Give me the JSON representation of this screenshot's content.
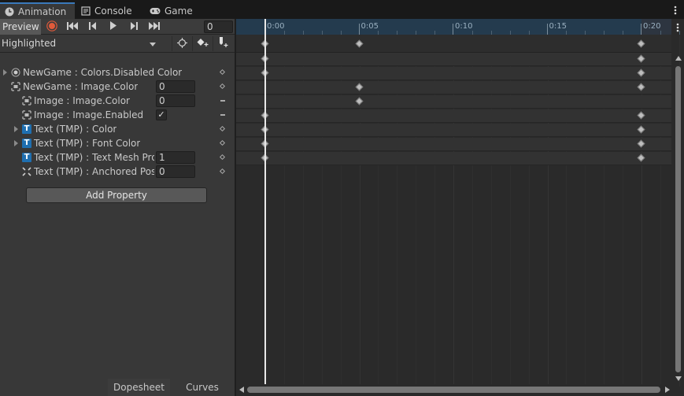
{
  "tabs": [
    {
      "label": "Animation",
      "icon": "clock-icon"
    },
    {
      "label": "Console",
      "icon": "console-icon"
    },
    {
      "label": "Game",
      "icon": "gamepad-icon"
    }
  ],
  "toolbar": {
    "preview_label": "Preview",
    "frame_value": "0",
    "buttons": [
      "record-icon",
      "first-key-icon",
      "prev-key-icon",
      "play-icon",
      "next-key-icon",
      "last-key-icon"
    ]
  },
  "clip": {
    "selected": "Highlighted"
  },
  "properties": [
    {
      "label": "NewGame : Colors.Disabled Color",
      "icon": "target-icon",
      "expandable": true,
      "value": "",
      "type": "none",
      "right": "diamond"
    },
    {
      "label": "NewGame : Image.Color",
      "icon": "image-icon",
      "expandable": false,
      "value": "0",
      "type": "field",
      "right": "diamond"
    },
    {
      "label": "Image : Image.Color",
      "icon": "image-icon",
      "expandable": false,
      "value": "0",
      "type": "field",
      "right": "dash"
    },
    {
      "label": "Image : Image.Enabled",
      "icon": "image-icon",
      "expandable": false,
      "value": "✓",
      "type": "check",
      "right": "dash"
    },
    {
      "label": "Text (TMP) : Color",
      "icon": "tmp-text-icon",
      "expandable": true,
      "value": "",
      "type": "none",
      "right": "diamond"
    },
    {
      "label": "Text (TMP) : Font Color",
      "icon": "tmp-text-icon",
      "expandable": true,
      "value": "",
      "type": "none",
      "right": "diamond"
    },
    {
      "label": "Text (TMP) : Text Mesh Pro",
      "icon": "tmp-text-icon",
      "expandable": false,
      "value": "1",
      "type": "field",
      "right": "diamond"
    },
    {
      "label": "Text (TMP) : Anchored Posi",
      "icon": "rect-transform-icon",
      "expandable": false,
      "value": "0",
      "type": "field",
      "right": "diamond"
    }
  ],
  "add_property_label": "Add Property",
  "bottom_tabs": {
    "dopesheet": "Dopesheet",
    "curves": "Curves"
  },
  "timeline": {
    "labels": [
      "0:00",
      "0:05",
      "0:10",
      "0:15",
      "0:20"
    ],
    "playhead_time": "0:00",
    "summary_keys": [
      0,
      5,
      20
    ],
    "row_keys": [
      [
        0,
        20
      ],
      [
        0,
        20
      ],
      [
        5,
        20
      ],
      [
        5
      ],
      [
        0,
        20
      ],
      [
        0,
        20
      ],
      [
        0,
        20
      ],
      [
        0,
        20
      ]
    ]
  },
  "colors": {
    "accent": "#3a79bb",
    "record": "#e05a3a",
    "ruler": "#243b4e"
  }
}
